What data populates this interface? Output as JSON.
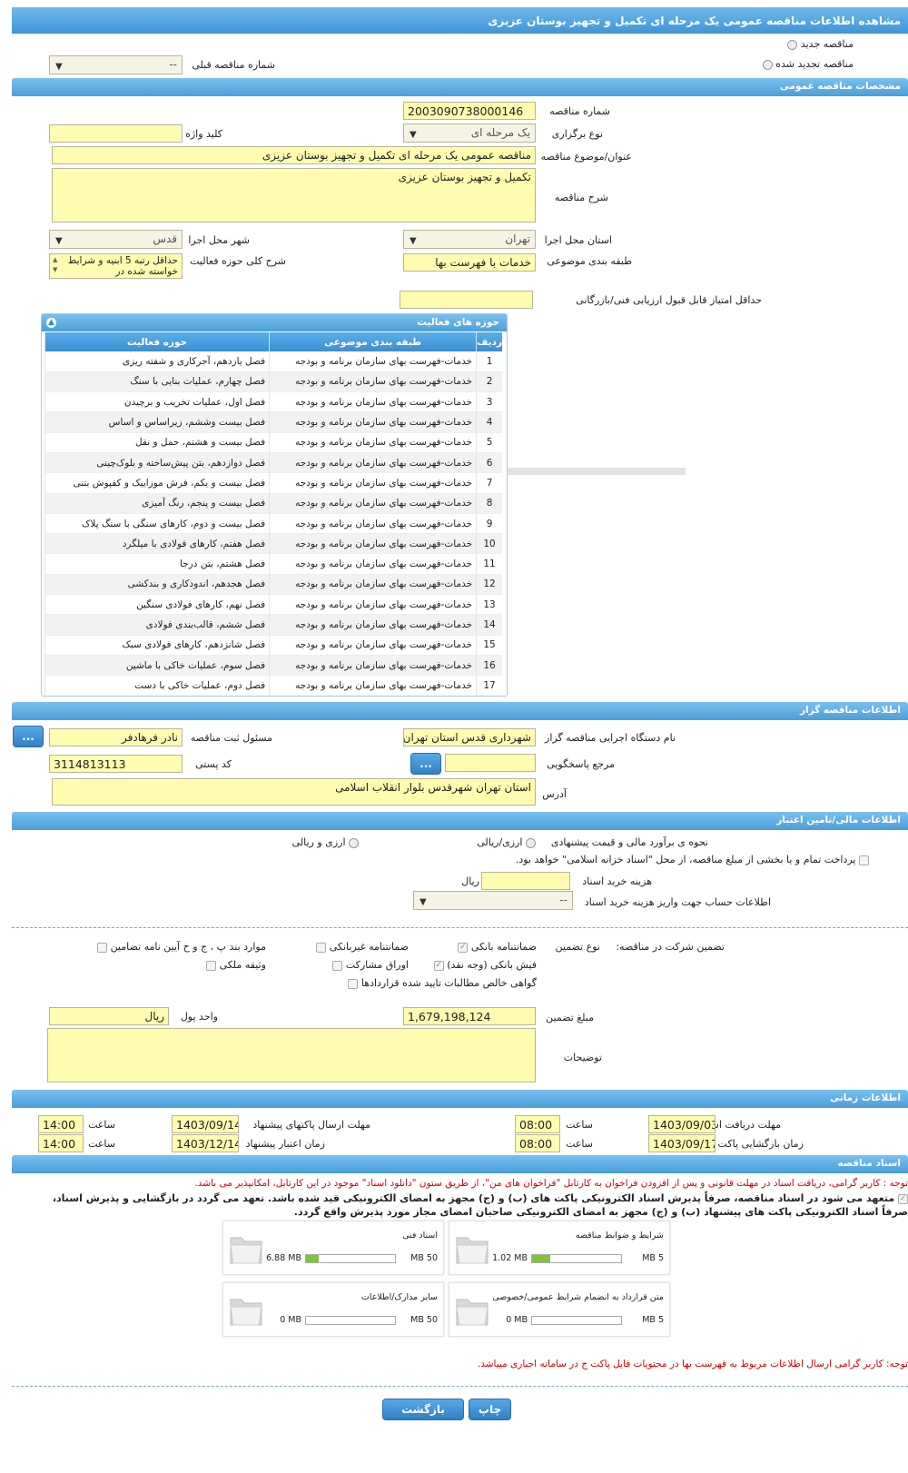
{
  "page_title": "مشاهده اطلاعات مناقصه عمومی یک مرحله ای تکمیل و تجهیز بوستان عزیزی",
  "top": {
    "new_tender": "مناقصه جدید",
    "renewed_tender": "مناقصه تجدید شده",
    "prev_tender_label": "شماره مناقصه قبلی",
    "prev_tender_value": "--"
  },
  "general": {
    "section": "مشخصات مناقصه عمومی",
    "tender_no_label": "شماره مناقصه",
    "tender_no": "2003090738000146",
    "holding_type_label": "نوع برگزاری",
    "holding_type": "یک مرحله ای",
    "keyword_label": "کلید واژه",
    "keyword": "",
    "subject_label": "عنوان/موضوع مناقصه",
    "subject": "مناقصه عمومی یک مرحله ای تکمیل و تجهیز بوستان عزیزی",
    "desc_label": "شرح مناقصه",
    "desc": "تکمیل و تجهیز بوستان عزیزی",
    "province_label": "استان محل اجرا",
    "province": "تهران",
    "city_label": "شهر محل اجرا",
    "city": "قدس",
    "category_label": "طبقه بندی موضوعی",
    "category": "خدمات با فهرست بها",
    "scope_label": "شرح کلی حوزه فعالیت",
    "scope": "حداقل رتبه 5 ابنیه و شرایط خواسته شده در",
    "min_score_label": "حداقل امتیاز قابل قبول ارزیابی فنی/بازرگانی",
    "min_score": ""
  },
  "activities": {
    "title": "حوزه های فعالیت",
    "col_row": "ردیف",
    "col_cat": "طبقه بندی موضوعی",
    "col_field": "حوزه فعالیت",
    "rows": [
      {
        "n": "1",
        "cat": "خدمات-فهرست بهای سازمان برنامه و بودجه",
        "field": "فصل یازدهم، آجرکاری و شفته ریزی"
      },
      {
        "n": "2",
        "cat": "خدمات-فهرست بهای سازمان برنامه و بودجه",
        "field": "فصل چهارم، عملیات بنایی با سنگ"
      },
      {
        "n": "3",
        "cat": "خدمات-فهرست بهای سازمان برنامه و بودجه",
        "field": "فصل اول، عملیات تخریب و برچیدن"
      },
      {
        "n": "4",
        "cat": "خدمات-فهرست بهای سازمان برنامه و بودجه",
        "field": "فصل بیست وششم، زیراساس و اساس"
      },
      {
        "n": "5",
        "cat": "خدمات-فهرست بهای سازمان برنامه و بودجه",
        "field": "فصل بیست و هشتم، حمل و نقل"
      },
      {
        "n": "6",
        "cat": "خدمات-فهرست بهای سازمان برنامه و بودجه",
        "field": "فصل دوازدهم، بتن پیش‌ساخته و بلوک‌چینی"
      },
      {
        "n": "7",
        "cat": "خدمات-فهرست بهای سازمان برنامه و بودجه",
        "field": "فصل بیست و یکم، فرش موزاییک و کفپوش بتنی"
      },
      {
        "n": "8",
        "cat": "خدمات-فهرست بهای سازمان برنامه و بودجه",
        "field": "فصل بیست و پنجم، رنگ آمیزی"
      },
      {
        "n": "9",
        "cat": "خدمات-فهرست بهای سازمان برنامه و بودجه",
        "field": "فصل بیست و دوم، کارهای سنگی با سنگ پلاک"
      },
      {
        "n": "10",
        "cat": "خدمات-فهرست بهای سازمان برنامه و بودجه",
        "field": "فصل هفتم، کارهای فولادی با میلگرد"
      },
      {
        "n": "11",
        "cat": "خدمات-فهرست بهای سازمان برنامه و بودجه",
        "field": "فصل هشتم، بتن درجا"
      },
      {
        "n": "12",
        "cat": "خدمات-فهرست بهای سازمان برنامه و بودجه",
        "field": "فصل هجدهم، اندودکاری و بندکشی"
      },
      {
        "n": "13",
        "cat": "خدمات-فهرست بهای سازمان برنامه و بودجه",
        "field": "فصل نهم، کارهای فولادی سنگین"
      },
      {
        "n": "14",
        "cat": "خدمات-فهرست بهای سازمان برنامه و بودجه",
        "field": "فصل ششم، قالب‌بندی فولادی"
      },
      {
        "n": "15",
        "cat": "خدمات-فهرست بهای سازمان برنامه و بودجه",
        "field": "فصل شانزدهم، کارهای فولادی سبک"
      },
      {
        "n": "16",
        "cat": "خدمات-فهرست بهای سازمان برنامه و بودجه",
        "field": "فصل سوم، عملیات خاکی با ماشین"
      },
      {
        "n": "17",
        "cat": "خدمات-فهرست بهای سازمان برنامه و بودجه",
        "field": "فصل دوم، عملیات خاکی با دست"
      }
    ]
  },
  "organizer": {
    "section": "اطلاعات مناقصه گزار",
    "org_label": "نام دستگاه اجرایی مناقصه گزار",
    "org": "شهرداری قدس استان تهران",
    "officer_label": "مسئول ثبت مناقصه",
    "officer": "نادر فرهادفر",
    "ref_label": "مرجع پاسخگویی",
    "postal_label": "کد پستی",
    "postal": "3114813113",
    "address_label": "آدرس",
    "address": "استان تهران شهرقدس بلوار انقلاب اسلامی",
    "btn": "..."
  },
  "finance": {
    "section": "اطلاعات مالی/تامین اعتبار",
    "method_label": "نحوه ی برآورد مالی و قیمت پیشنهادی",
    "opt_rial": "ارزی/ریالی",
    "opt_both": "ارزی و ریالی",
    "treasury": "پرداخت تمام و یا بخشی از مبلغ مناقصه، از محل \"اسناد خزانه اسلامی\" خواهد بود.",
    "doc_cost_label": "هزینه خرید اسناد",
    "doc_cost_unit": "ریال",
    "account_label": "اطلاعات حساب جهت واریز هزینه خرید اسناد",
    "account": "--"
  },
  "guarantee": {
    "label": "تضمین شرکت در مناقصه:",
    "type_label": "نوع تضمین",
    "opts": [
      "ضمانتنامه بانکی",
      "ضمانتنامه غیربانکی",
      "موارد بند پ ، ج و خ آیین نامه تضامین",
      "فیش بانکی (وجه نقد)",
      "اوراق مشارکت",
      "وثیقه ملکی",
      "گواهی خالص مطالبات تایید شده قراردادها"
    ],
    "amount_label": "مبلغ تضمین",
    "amount": "1,679,198,124",
    "currency_label": "واحد پول",
    "currency": "ریال",
    "notes_label": "توضیحات"
  },
  "timing": {
    "section": "اطلاعات زمانی",
    "get_docs_label": "مهلت دریافت اسناد",
    "get_docs": "1403/09/03",
    "get_time": "08:00",
    "send_label": "مهلت ارسال پاکتهای پیشنهاد",
    "send": "1403/09/14",
    "send_time": "14:00",
    "open_label": "زمان بازگشایی پاکت ها",
    "open": "1403/09/17",
    "open_time": "08:00",
    "valid_label": "زمان اعتبار پیشنهاد",
    "valid": "1403/12/14",
    "valid_time": "14:00",
    "time_label": "ساعت"
  },
  "docs": {
    "section": "اسناد مناقصه",
    "note1": "توجه : کاربر گرامی، دریافت اسناد در مهلت قانونی و پس از افزودن فراخوان به کارتابل \"فراخوان های من\"، از طریق ستون \"دانلود اسناد\" موجود در این کارتابل، امکانپذیر می باشد.",
    "note2": "متعهد می شود در اسناد مناقصه، صرفاً پذیرش اسناد الکترونیکی پاکت های (ب) و (ج) مجهز به امضای الکترونیکی قید شده باشد. تعهد می گردد در بازگشایی و پذیرش اسناد،",
    "note3": "صرفاً اسناد الکترونیکی پاکت های پیشنهاد (ب) و (ج) مجهز به امضای الکترونیکی صاحبان امضای مجاز مورد پذیرش واقع گردد.",
    "files": [
      {
        "title": "شرایط و ضوابط مناقصه",
        "cur": "1.02 MB",
        "max": "5 MB",
        "pct": 20
      },
      {
        "title": "اسناد فنی",
        "cur": "6.88 MB",
        "max": "50 MB",
        "pct": 14
      },
      {
        "title": "متن قرارداد به انضمام شرایط عمومی/خصوصی",
        "cur": "0 MB",
        "max": "5 MB",
        "pct": 0
      },
      {
        "title": "سایر مدارک/اطلاعات",
        "cur": "0 MB",
        "max": "50 MB",
        "pct": 0
      }
    ],
    "note4": "توجه: کاربر گرامی ارسال اطلاعات مربوط به فهرست بها در محتویات فایل پاکت ج در سامانه اجباری میباشد."
  },
  "footer": {
    "print": "چاپ",
    "back": "بازگشت"
  }
}
